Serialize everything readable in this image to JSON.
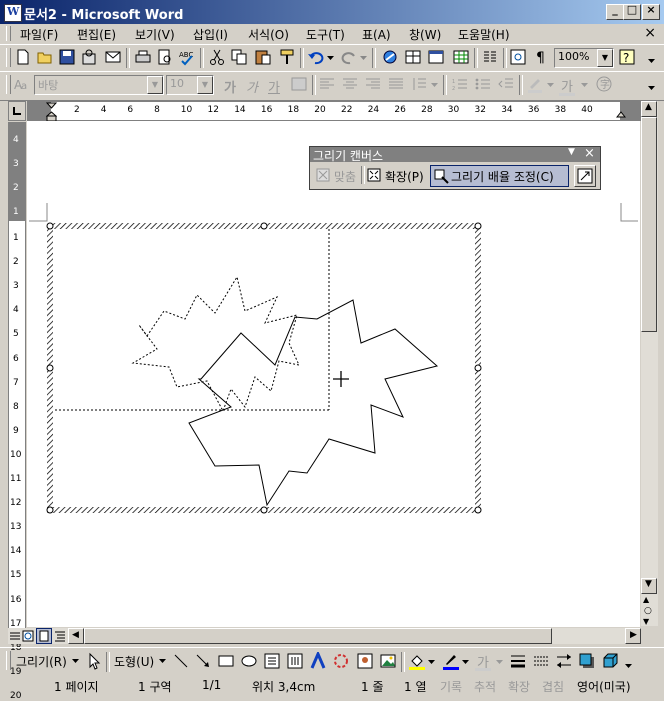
{
  "window": {
    "title": "문서2 - Microsoft Word",
    "app_icon": "W",
    "minimize_glyph": "_",
    "maximize_glyph": "□",
    "close_glyph": "×"
  },
  "menu": {
    "items": [
      "파일(F)",
      "편집(E)",
      "보기(V)",
      "삽입(I)",
      "서식(O)",
      "도구(T)",
      "표(A)",
      "창(W)",
      "도움말(H)"
    ],
    "doc_close": "×"
  },
  "standard_toolbar": {
    "zoom": "100%"
  },
  "formatting_toolbar": {
    "style_name": "바탕",
    "font_size": "10",
    "bold": "가",
    "italic": "가",
    "underline": "가",
    "font_color_glyph": "가"
  },
  "ruler": {
    "h_labels": [
      "2",
      "4",
      "6",
      "8",
      "10",
      "12",
      "14",
      "16",
      "18",
      "20",
      "22",
      "24",
      "26",
      "28",
      "30",
      "32",
      "34",
      "36",
      "38",
      "40"
    ],
    "v_top_labels": [
      "1",
      "2",
      "3",
      "4"
    ],
    "v_labels": [
      "1",
      "2",
      "3",
      "4",
      "5",
      "6",
      "7",
      "8",
      "9",
      "10",
      "11",
      "12",
      "13",
      "14",
      "15",
      "16",
      "17",
      "18",
      "19",
      "20"
    ]
  },
  "canvas_toolbar": {
    "title": "그리기 캔버스",
    "fit_label": "맞춤",
    "expand_label": "확장(P)",
    "scale_label": "그리기 배율 조정(C)"
  },
  "drawing_toolbar": {
    "draw_menu": "그리기(R)",
    "autoshapes_menu": "도형(U)"
  },
  "statusbar": {
    "page": "1 페이지",
    "section": "1 구역",
    "page_of": "1/1",
    "position": "위치 3,4cm",
    "line": "1 줄",
    "column": "1 열",
    "rec": "기록",
    "trk": "추적",
    "ext": "확장",
    "ovr": "겹침",
    "language": "영어(미국)"
  },
  "colors": {
    "title_start": "#0a246a",
    "title_end": "#a6caf0",
    "face": "#d4d0c8",
    "highlight_color": "#ffff00",
    "font_color": "#ff0000"
  }
}
